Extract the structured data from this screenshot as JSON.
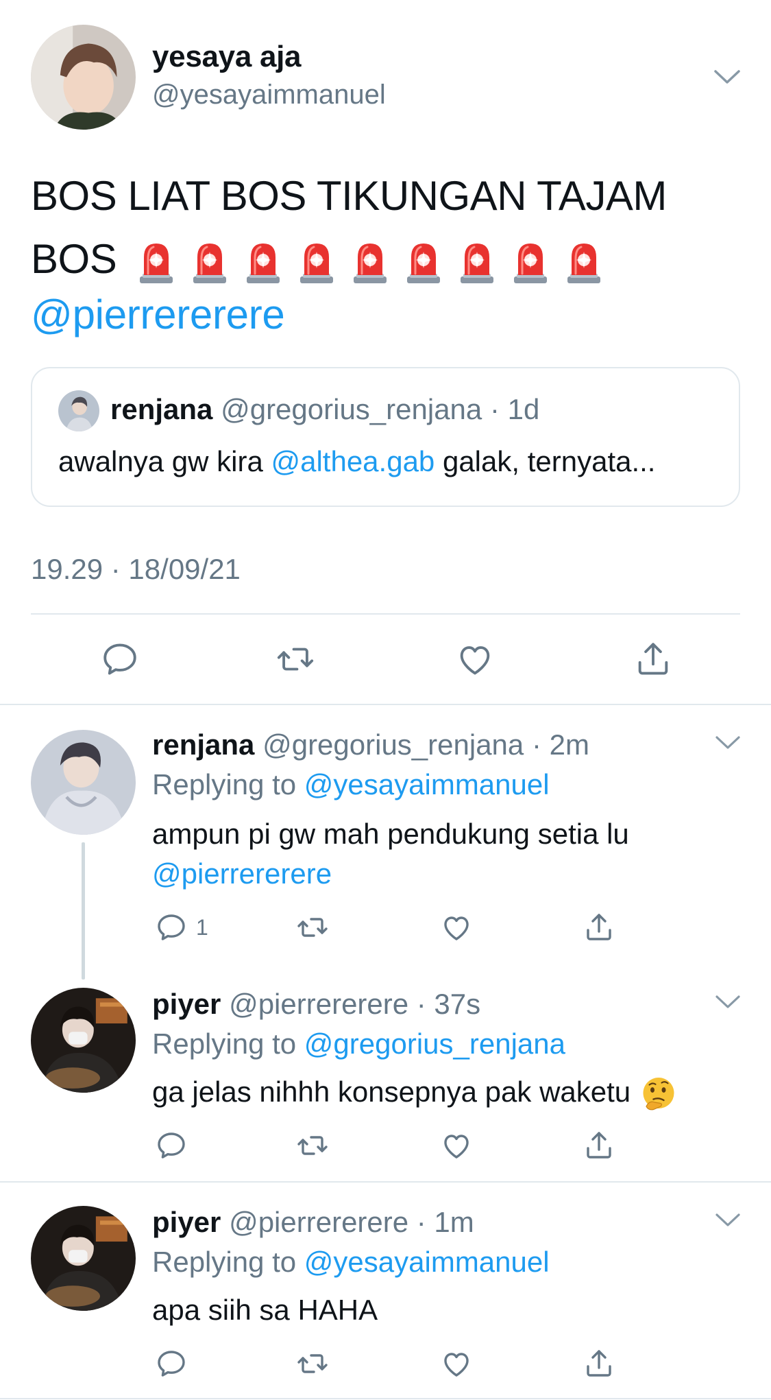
{
  "main_tweet": {
    "name": "yesaya aja",
    "handle": "@yesayaimmanuel",
    "text_line1": "BOS LIAT BOS TIKUNGAN TAJAM",
    "text_line2": "BOS",
    "emoji": "police-car-light",
    "emoji_count": 9,
    "mention": "@pierrererere",
    "timestamp": "19.29 · 18/09/21",
    "quoted": {
      "name": "renjana",
      "handle_time": "@gregorius_renjana · 1d",
      "text_before": "awalnya gw kira ",
      "mention": "@althea.gab",
      "text_after": " galak, ternyata..."
    }
  },
  "replies": [
    {
      "name": "renjana",
      "handle_time": "@gregorius_renjana · 2m",
      "replying_prefix": "Replying to ",
      "replying_to": "@yesayaimmanuel",
      "text_line1": "ampun pi gw mah pendukung setia lu",
      "text_line2_mention": "@pierrererere",
      "reply_count": "1"
    },
    {
      "name": "piyer",
      "handle_time": "@pierrererere · 37s",
      "replying_prefix": "Replying to ",
      "replying_to": "@gregorius_renjana",
      "text": "ga jelas nihhh konsepnya pak waketu",
      "emoji": "thinking-face"
    },
    {
      "name": "piyer",
      "handle_time": "@pierrererere · 1m",
      "replying_prefix": "Replying to ",
      "replying_to": "@yesayaimmanuel",
      "text": "apa siih sa HAHA"
    }
  ],
  "colors": {
    "link": "#1d9bf0",
    "muted": "#657786",
    "divider": "#e1e8ed",
    "icon": "#657786"
  }
}
